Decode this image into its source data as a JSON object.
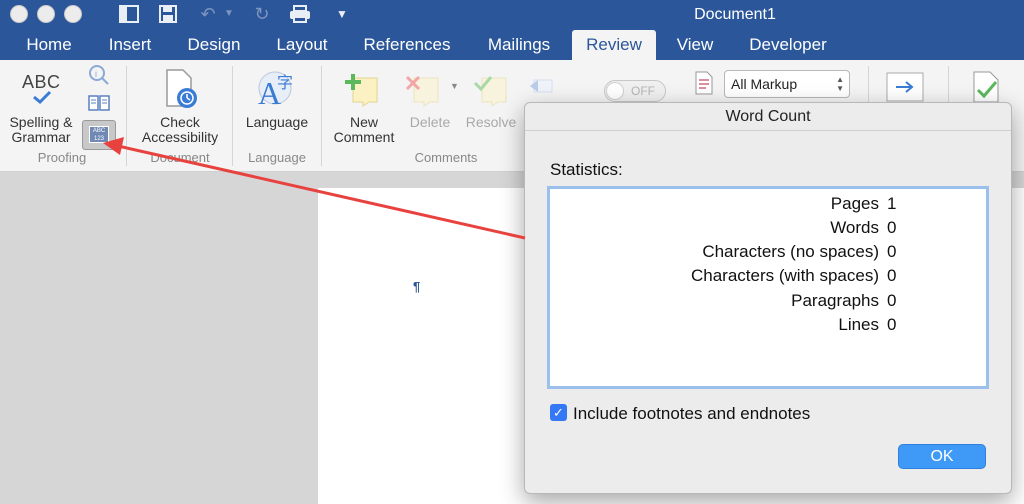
{
  "window": {
    "title": "Document1"
  },
  "quick_access": {
    "icons": [
      "sidebar-icon",
      "save-icon",
      "undo-icon",
      "redo-icon",
      "print-icon",
      "customize-icon"
    ]
  },
  "tabs": [
    {
      "label": "Home",
      "active": false
    },
    {
      "label": "Insert",
      "active": false
    },
    {
      "label": "Design",
      "active": false
    },
    {
      "label": "Layout",
      "active": false
    },
    {
      "label": "References",
      "active": false
    },
    {
      "label": "Mailings",
      "active": false
    },
    {
      "label": "Review",
      "active": true
    },
    {
      "label": "View",
      "active": false
    },
    {
      "label": "Developer",
      "active": false
    }
  ],
  "ribbon": {
    "abc_text": "ABC",
    "word_count_icon_text": "ABC 123",
    "spelling_line1": "Spelling &",
    "spelling_line2": "Grammar",
    "group_proofing": "Proofing",
    "check_line1": "Check",
    "check_line2": "Accessibility",
    "group_document": "Document",
    "language_label": "Language",
    "group_language": "Language",
    "new_line1": "New",
    "new_line2": "Comment",
    "delete_label": "Delete",
    "resolve_label": "Resolve",
    "group_comments": "Comments",
    "track_toggle": "OFF",
    "markup_value": "All Markup"
  },
  "document": {
    "pilcrow": "¶"
  },
  "dialog": {
    "title": "Word Count",
    "statistics_label": "Statistics:",
    "rows": [
      {
        "label": "Pages",
        "value": "1"
      },
      {
        "label": "Words",
        "value": "0"
      },
      {
        "label": "Characters (no spaces)",
        "value": "0"
      },
      {
        "label": "Characters (with spaces)",
        "value": "0"
      },
      {
        "label": "Paragraphs",
        "value": "0"
      },
      {
        "label": "Lines",
        "value": "0"
      }
    ],
    "include_footnotes_label": "Include footnotes and endnotes",
    "include_footnotes_checked": true,
    "ok_label": "OK"
  },
  "colors": {
    "brand_blue": "#2b579a",
    "annotation_arrow": "#e8423f",
    "ok_button": "#3f9af7"
  }
}
